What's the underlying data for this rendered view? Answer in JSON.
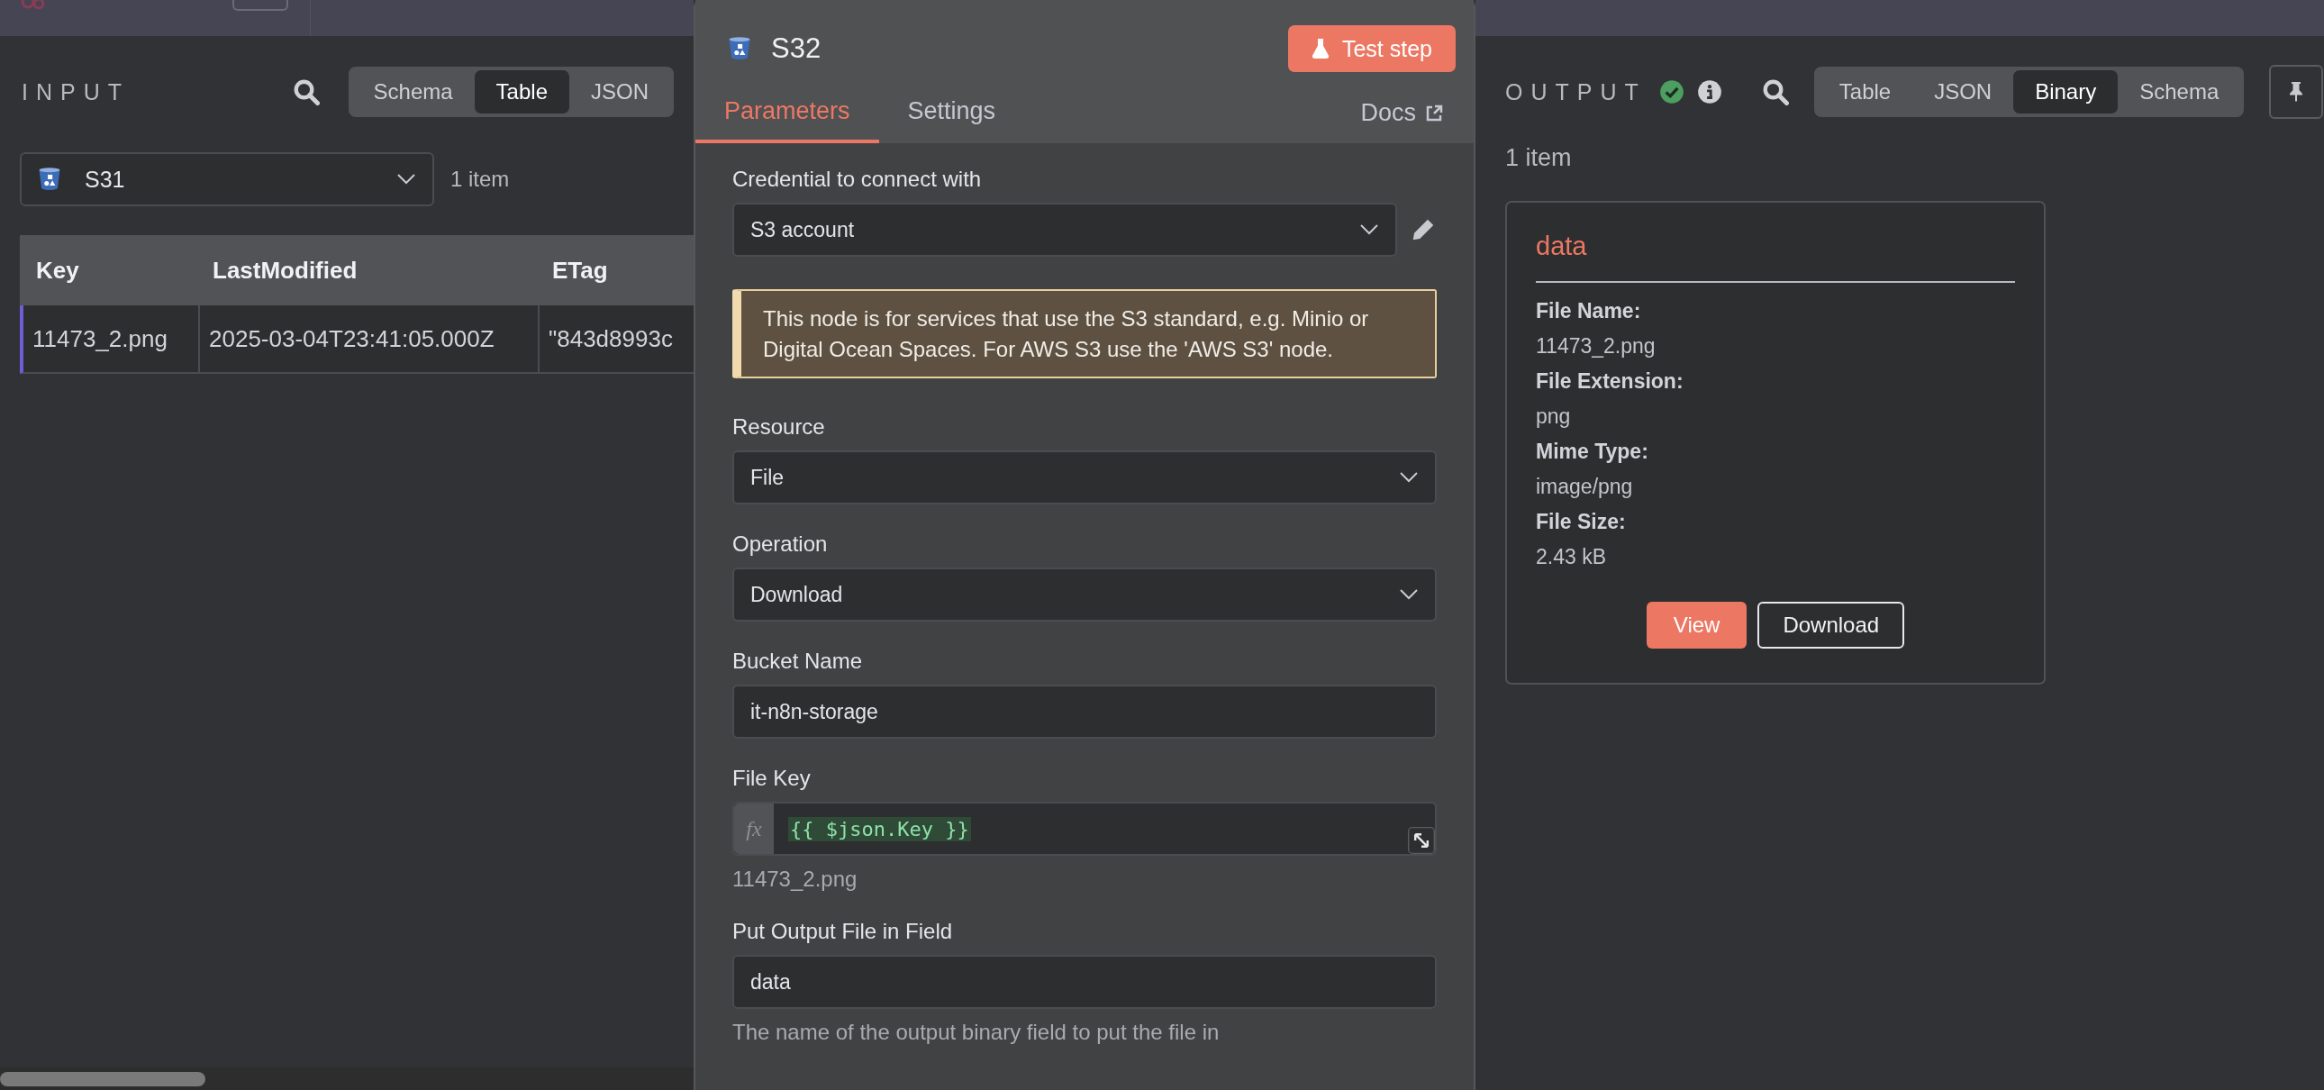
{
  "input_panel": {
    "label": "INPUT",
    "view_tabs": [
      {
        "label": "Schema",
        "selected": false
      },
      {
        "label": "Table",
        "selected": true
      },
      {
        "label": "JSON",
        "selected": false
      }
    ],
    "node_select": {
      "value": "S31"
    },
    "item_count": "1 item",
    "table": {
      "columns": [
        "Key",
        "LastModified",
        "ETag"
      ],
      "rows": [
        {
          "cells": [
            "11473_2.png",
            "2025-03-04T23:41:05.000Z",
            "\"843d8993c"
          ],
          "selected": true
        }
      ]
    }
  },
  "node_panel": {
    "title": "S32",
    "test_button": "Test step",
    "tabs": [
      {
        "label": "Parameters",
        "selected": true
      },
      {
        "label": "Settings",
        "selected": false
      }
    ],
    "docs_link": "Docs",
    "fields": [
      {
        "kind": "credential",
        "label": "Credential to connect with",
        "value": "S3 account"
      },
      {
        "kind": "notice",
        "text": "This node is for services that use the S3 standard, e.g. Minio or Digital Ocean Spaces. For AWS S3 use the 'AWS S3' node."
      },
      {
        "kind": "select",
        "label": "Resource",
        "value": "File"
      },
      {
        "kind": "select",
        "label": "Operation",
        "value": "Download"
      },
      {
        "kind": "input",
        "label": "Bucket Name",
        "value": "it-n8n-storage"
      },
      {
        "kind": "expression",
        "label": "File Key",
        "prefix": "fx",
        "value": "{{ $json.Key }}",
        "preview": "11473_2.png"
      },
      {
        "kind": "input",
        "label": "Put Output File in Field",
        "value": "data",
        "hint": "The name of the output binary field to put the file in"
      }
    ]
  },
  "output_panel": {
    "label": "OUTPUT",
    "view_tabs": [
      {
        "label": "Table",
        "selected": false
      },
      {
        "label": "JSON",
        "selected": false
      },
      {
        "label": "Binary",
        "selected": true
      },
      {
        "label": "Schema",
        "selected": false
      }
    ],
    "item_count": "1 item",
    "binary_card": {
      "title": "data",
      "properties": [
        {
          "label": "File Name:",
          "value": "11473_2.png"
        },
        {
          "label": "File Extension:",
          "value": "png"
        },
        {
          "label": "Mime Type:",
          "value": "image/png"
        },
        {
          "label": "File Size:",
          "value": "2.43 kB"
        }
      ],
      "buttons": [
        {
          "label": "View",
          "kind": "primary"
        },
        {
          "label": "Download",
          "kind": "secondary"
        }
      ]
    }
  }
}
